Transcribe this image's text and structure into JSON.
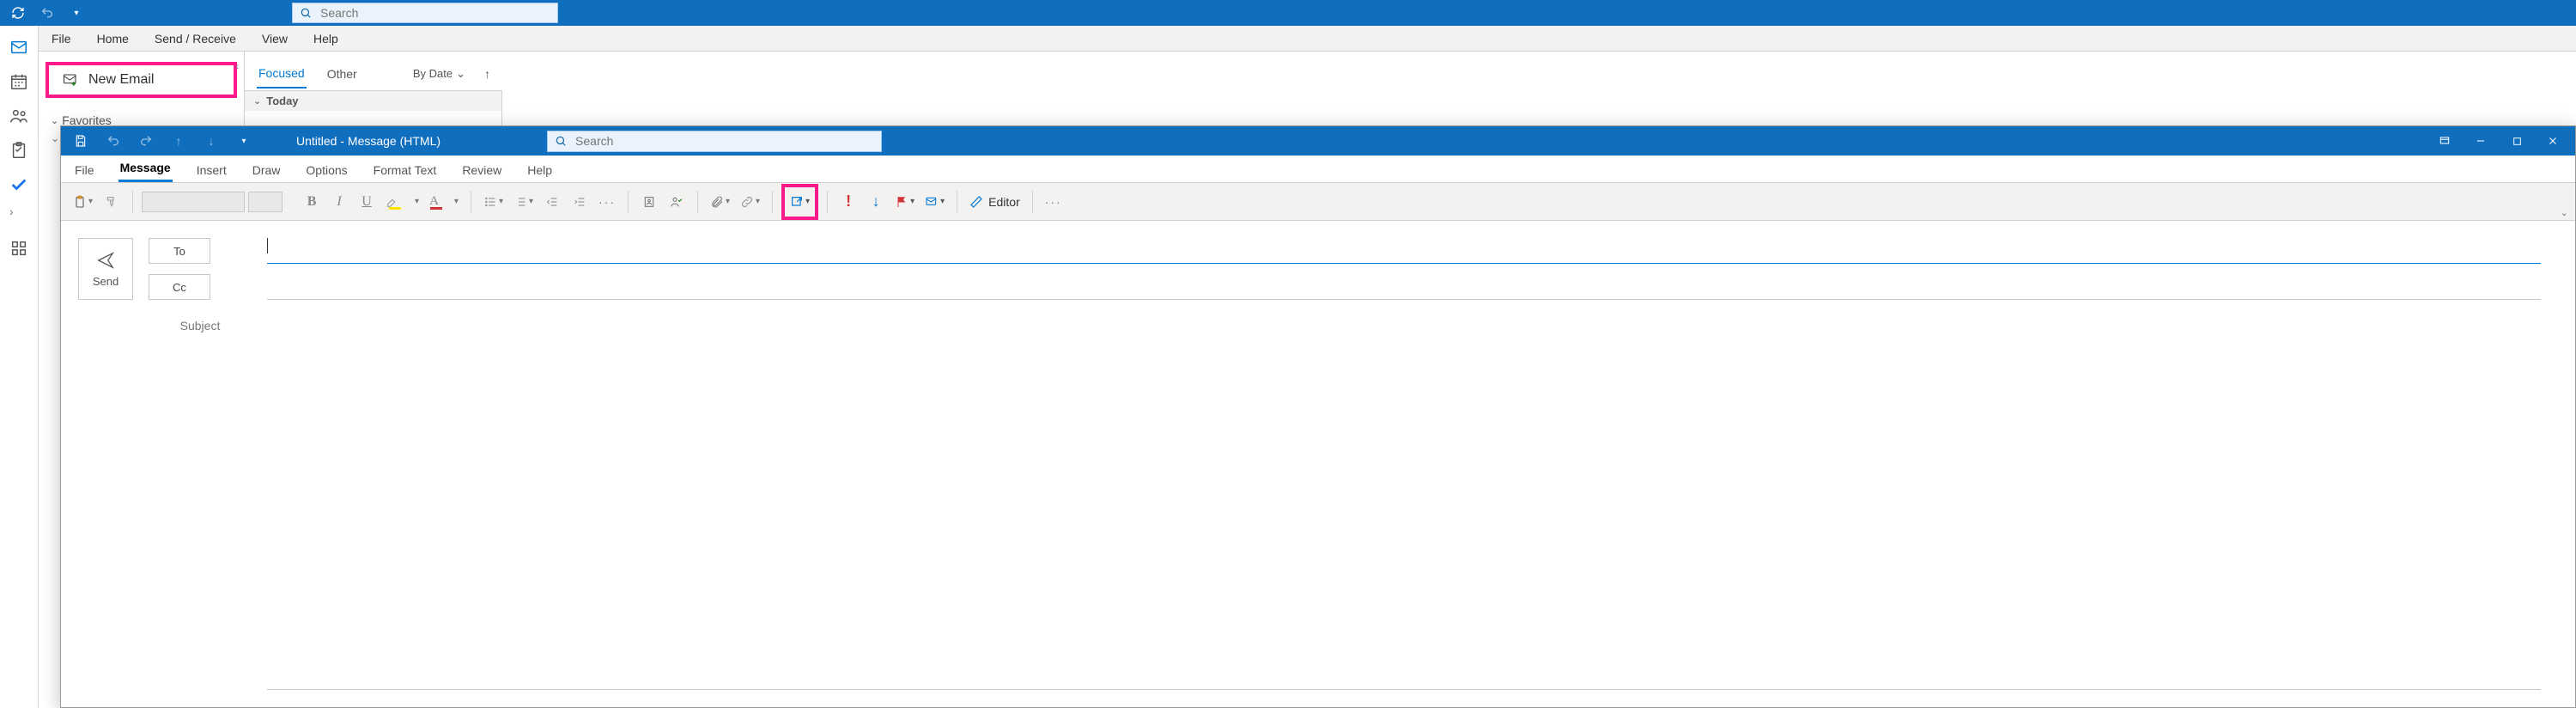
{
  "main": {
    "search_placeholder": "Search",
    "menu": {
      "file": "File",
      "home": "Home",
      "send_receive": "Send / Receive",
      "view": "View",
      "help": "Help"
    },
    "nav": {
      "new_email": "New Email",
      "favorites": "Favorites"
    },
    "mail_list": {
      "tab_focused": "Focused",
      "tab_other": "Other",
      "sort_label": "By Date",
      "group_today": "Today"
    }
  },
  "compose": {
    "title": "Untitled  -  Message (HTML)",
    "search_placeholder": "Search",
    "menu": {
      "file": "File",
      "message": "Message",
      "insert": "Insert",
      "draw": "Draw",
      "options": "Options",
      "format_text": "Format Text",
      "review": "Review",
      "help": "Help"
    },
    "ribbon": {
      "editor": "Editor"
    },
    "body": {
      "send": "Send",
      "to": "To",
      "cc": "Cc",
      "subject_label": "Subject"
    }
  }
}
